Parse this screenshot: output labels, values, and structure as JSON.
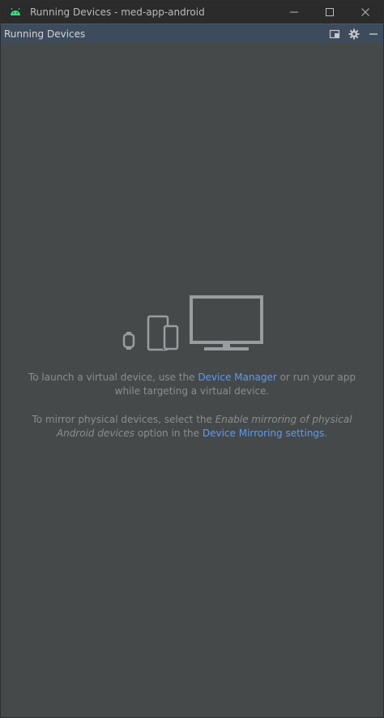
{
  "window": {
    "title": "Running Devices - med-app-android"
  },
  "tool_window": {
    "title": "Running Devices"
  },
  "empty_state": {
    "launch": {
      "prefix": "To launch a virtual device, use the ",
      "link": "Device Manager",
      "suffix": " or run your app while targeting a virtual device."
    },
    "mirror": {
      "prefix": "To mirror physical devices, select the ",
      "italic": "Enable mirroring of physical Android devices",
      "middle": " option in the ",
      "link": "Device Mirroring settings",
      "suffix": "."
    }
  },
  "icons": {
    "app": "android-icon",
    "minimize": "minimize-icon",
    "maximize": "maximize-icon",
    "close": "close-icon",
    "options": "window-options-icon",
    "settings": "gear-icon",
    "hide": "hide-icon"
  },
  "colors": {
    "link": "#589df6",
    "text": "#8b8e90",
    "header": "#3d4b5c",
    "background": "#45494a"
  }
}
